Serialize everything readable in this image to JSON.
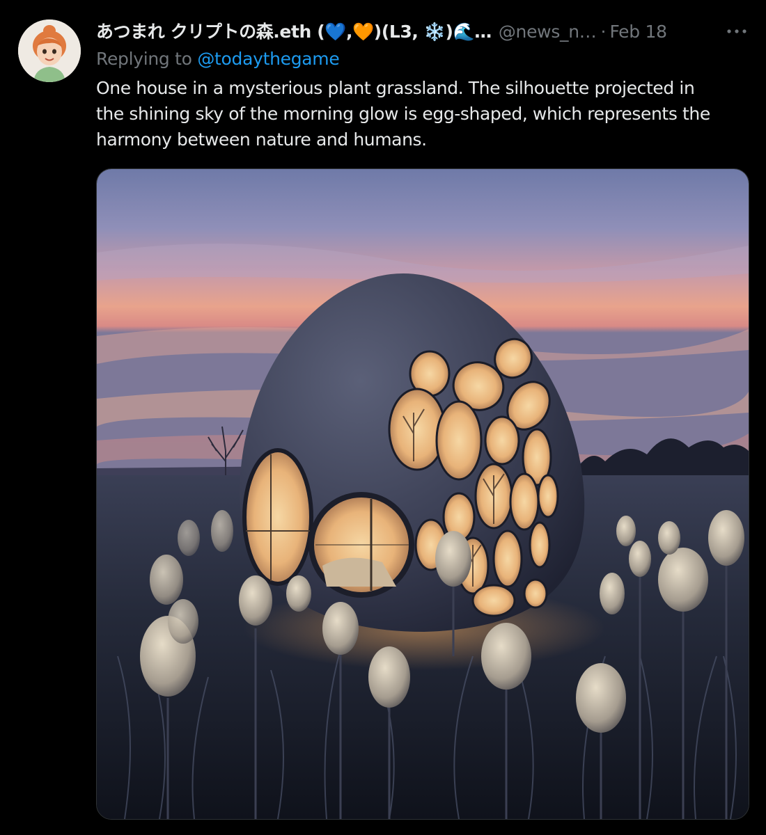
{
  "tweet": {
    "author": {
      "display_name": "あつまれ クリプトの森.eth (💙,🧡)(L3, ❄️)🌊…",
      "handle": "@news_n…",
      "avatar_icon": "user-avatar-icon"
    },
    "separator": "·",
    "date": "Feb 18",
    "more_icon": "more-options-icon",
    "replying": {
      "prefix": "Replying to",
      "mention": "@todaythegame"
    },
    "text": "One house in a mysterious plant grassland. The silhouette projected in\nthe shining sky of the morning glow is egg-shaped, which represents the\nharmony between nature and humans.",
    "media": {
      "icon": "egg-house-photo"
    }
  },
  "colors": {
    "background": "#000000",
    "text": "#e7e9ea",
    "secondary": "#71767b",
    "link": "#1d9bf0"
  }
}
